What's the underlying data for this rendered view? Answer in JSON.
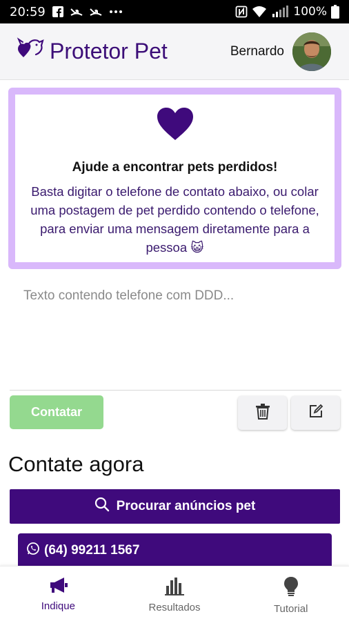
{
  "status_bar": {
    "time": "20:59",
    "battery": "100%",
    "icons": [
      "facebook-icon",
      "missed-call-icon",
      "missed-call-icon",
      "more-dots-icon",
      "nfc-icon",
      "wifi-icon",
      "signal-icon",
      "battery-icon"
    ]
  },
  "header": {
    "app_title": "Protetor Pet",
    "user_name": "Bernardo",
    "logo_icon": "pet-heart-logo-icon"
  },
  "info_card": {
    "icon": "heart-icon",
    "title": "Ajude a encontrar pets perdidos!",
    "body": "Basta digitar o telefone de contato abaixo, ou colar uma postagem de pet perdido contendo o telefone, para enviar uma mensagem diretamente para a pessoa 😺"
  },
  "input": {
    "placeholder": "Texto contendo telefone com DDD...",
    "value": ""
  },
  "actions": {
    "contact_label": "Contatar",
    "delete_icon": "trash-icon",
    "edit_icon": "edit-icon"
  },
  "contact_now": {
    "title": "Contate agora",
    "search_label": "Procurar anúncios pet",
    "phone": "(64) 99211 1567"
  },
  "nav": {
    "items": [
      {
        "label": "Indique",
        "icon": "megaphone-icon",
        "active": true
      },
      {
        "label": "Resultados",
        "icon": "bar-chart-icon",
        "active": false
      },
      {
        "label": "Tutorial",
        "icon": "lightbulb-icon",
        "active": false
      }
    ]
  },
  "colors": {
    "brand_purple": "#3f0a7c",
    "card_border": "#d9b8fb",
    "contact_green": "#94d98f"
  }
}
